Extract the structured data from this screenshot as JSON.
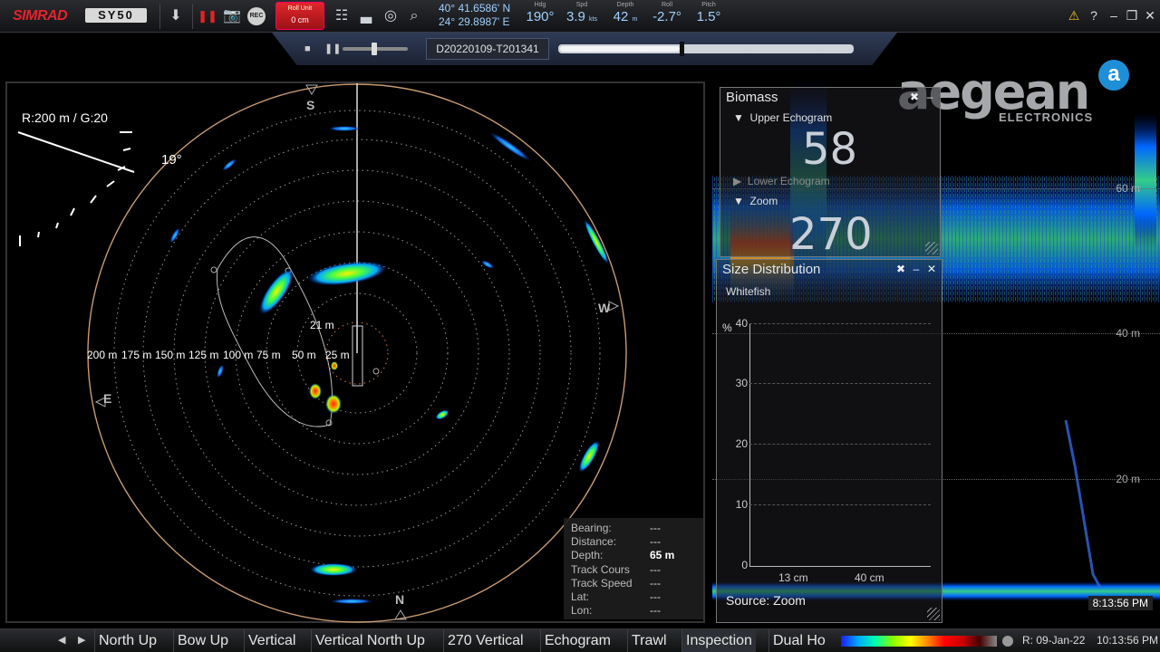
{
  "app": {
    "brand": "SIMRAD",
    "model": "SY50"
  },
  "toolbar": {
    "roll_unit_title": "Roll Unit",
    "roll_unit_value": "0 cm",
    "rec_label": "REC"
  },
  "nav": {
    "lat": "40° 41.6586' N",
    "lon": "24° 29.8987' E",
    "hdg_caption": "Hdg",
    "hdg_value": "190°",
    "spd_caption": "Spd",
    "spd_value": "3.9",
    "spd_unit": "kts",
    "depth_caption": "Depth",
    "depth_value": "42",
    "depth_unit": "m",
    "roll_caption": "Roll",
    "roll_value": "-2.7°",
    "pitch_caption": "Pitch",
    "pitch_value": "1.5°"
  },
  "playback": {
    "file": "D20220109-T201341",
    "position": 0.41
  },
  "sonar": {
    "range_gain": "R:200 m  / G:20",
    "tilt": "19°",
    "compass": {
      "s": "S",
      "w": "W",
      "e": "E",
      "n": "N"
    },
    "center_depth": "21 m",
    "ring_labels": [
      "200 m",
      "175 m",
      "150 m",
      "125 m",
      "100 m",
      "75 m",
      "50 m",
      "25 m"
    ],
    "info": {
      "bearing_label": "Bearing:",
      "bearing_value": "---",
      "distance_label": "Distance:",
      "distance_value": "---",
      "depth_label": "Depth:",
      "depth_value": "65 m",
      "track_course_label": "Track Cours",
      "track_course_value": "---",
      "track_speed_label": "Track Speed",
      "track_speed_value": "---",
      "lat_label": "Lat:",
      "lat_value": "---",
      "lon_label": "Lon:",
      "lon_value": "---"
    }
  },
  "echogram": {
    "depth_labels": [
      "60 m",
      "40 m",
      "20 m"
    ],
    "timestamp": "8:13:56 PM"
  },
  "watermark": {
    "name": "aegean",
    "sub": "ELECTRONICS",
    "badge": "a"
  },
  "biomass": {
    "title": "Biomass",
    "upper_label": "Upper Echogram",
    "upper_value": "58",
    "lower_label": "Lower Echogram",
    "zoom_label": "Zoom",
    "zoom_value": "270"
  },
  "size_distribution": {
    "title": "Size Distribution",
    "species": "Whitefish",
    "y_unit": "%",
    "y_ticks": [
      "40",
      "30",
      "20",
      "10",
      "0"
    ],
    "x_ticks": [
      "13 cm",
      "40 cm"
    ],
    "source": "Source: Zoom"
  },
  "bottom": {
    "tabs": [
      "North Up",
      "Bow Up",
      "Vertical",
      "Vertical North Up",
      "270 Vertical",
      "Echogram",
      "Trawl",
      "Inspection",
      "Dual Ho"
    ],
    "date": "R: 09-Jan-22",
    "time": "10:13:56 PM"
  },
  "colors": {
    "accent_red": "#e02424",
    "readout_blue": "#9fd0ff",
    "panel_border": "#777777"
  }
}
